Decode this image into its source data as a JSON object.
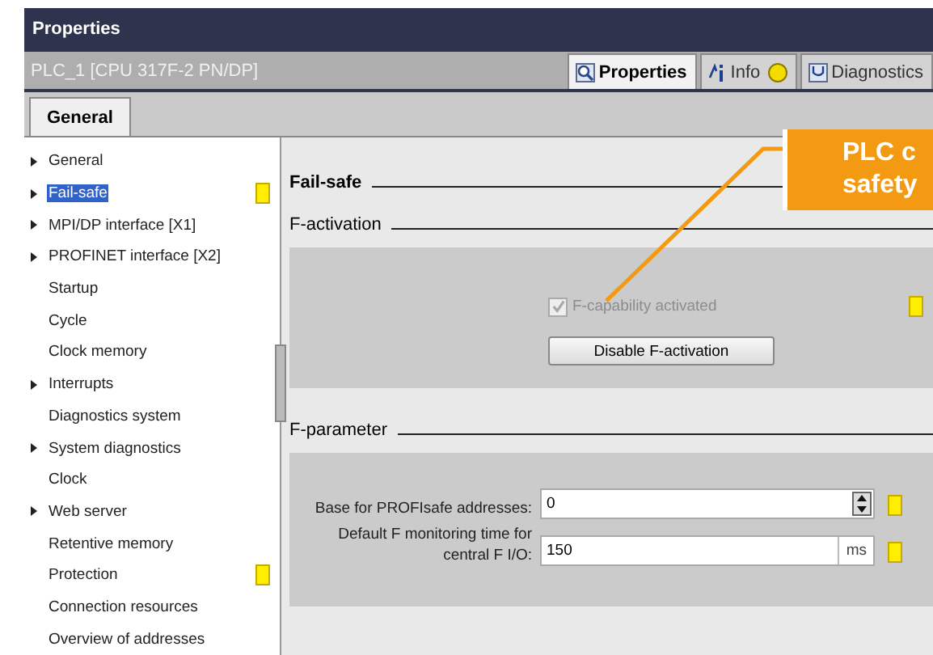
{
  "window": {
    "title": "Properties"
  },
  "object_bar": {
    "name": "PLC_1 [CPU 317F-2 PN/DP]"
  },
  "view_tabs": [
    {
      "label": "Properties",
      "selected": true,
      "info_badge": false
    },
    {
      "label": "Info",
      "selected": false,
      "info_badge": true
    },
    {
      "label": "Diagnostics",
      "selected": false,
      "info_badge": false
    }
  ],
  "page_tabs": [
    {
      "label": "General",
      "selected": true
    }
  ],
  "nav": [
    {
      "label": "General",
      "expandable": true,
      "selected": false,
      "marked": false
    },
    {
      "label": "Fail-safe",
      "expandable": true,
      "selected": true,
      "marked": true
    },
    {
      "label": "MPI/DP interface [X1]",
      "expandable": true,
      "selected": false,
      "marked": false
    },
    {
      "label": "PROFINET interface [X2]",
      "expandable": true,
      "selected": false,
      "marked": false
    },
    {
      "label": "Startup",
      "expandable": false,
      "selected": false,
      "marked": false
    },
    {
      "label": "Cycle",
      "expandable": false,
      "selected": false,
      "marked": false
    },
    {
      "label": "Clock memory",
      "expandable": false,
      "selected": false,
      "marked": false
    },
    {
      "label": "Interrupts",
      "expandable": true,
      "selected": false,
      "marked": false
    },
    {
      "label": "Diagnostics system",
      "expandable": false,
      "selected": false,
      "marked": false
    },
    {
      "label": "System diagnostics",
      "expandable": true,
      "selected": false,
      "marked": false
    },
    {
      "label": "Clock",
      "expandable": false,
      "selected": false,
      "marked": false
    },
    {
      "label": "Web server",
      "expandable": true,
      "selected": false,
      "marked": false
    },
    {
      "label": "Retentive memory",
      "expandable": false,
      "selected": false,
      "marked": false
    },
    {
      "label": "Protection",
      "expandable": false,
      "selected": false,
      "marked": true
    },
    {
      "label": "Connection resources",
      "expandable": false,
      "selected": false,
      "marked": false
    },
    {
      "label": "Overview of addresses",
      "expandable": false,
      "selected": false,
      "marked": false
    }
  ],
  "content": {
    "heading": "Fail-safe",
    "f_activation": {
      "heading": "F-activation",
      "checkbox": {
        "label": "F-capability activated",
        "checked": true,
        "disabled": true
      },
      "button": "Disable F-activation"
    },
    "f_parameter": {
      "heading": "F-parameter",
      "fields": [
        {
          "kind": "spin",
          "label": "Base for PROFIsafe addresses:",
          "value": "0"
        },
        {
          "kind": "unit",
          "label": "Default F monitoring time for central F I/O:",
          "value": "150",
          "unit": "ms"
        }
      ]
    }
  },
  "callout": {
    "lines": [
      "PLC c",
      "safety"
    ]
  }
}
